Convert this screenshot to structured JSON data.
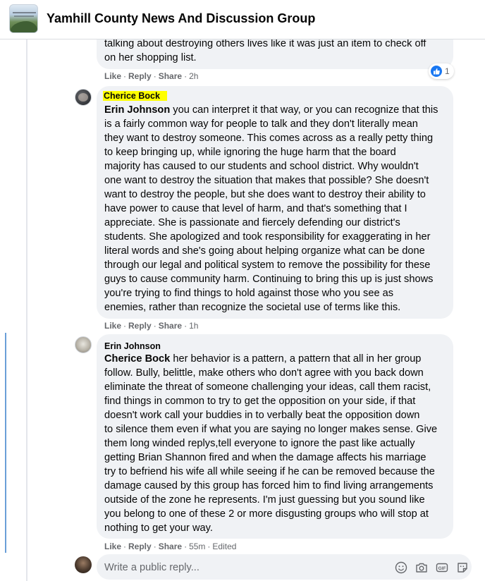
{
  "header": {
    "group_title": "Yamhill County News And Discussion Group"
  },
  "top_comment": {
    "lines": [
      "talking about destroying others lives like it was just an item to check off",
      "on her shopping list."
    ],
    "actions": {
      "like": "Like",
      "reply": "Reply",
      "share": "Share",
      "time": "2h"
    },
    "reaction": {
      "icon": "thumbs-up-icon",
      "count": "1",
      "color": "#1877f2"
    }
  },
  "cherice_comment": {
    "author": "Cherice Bock",
    "highlight_color": "#ffff00",
    "mention": "Erin Johnson",
    "first_line_rest": " you can interpret it that way, or you can recognize that this",
    "lines": [
      "is a fairly common way for people to talk and they don't literally mean",
      "they want to destroy someone. This comes across as a really petty thing",
      "to keep bringing up, while ignoring the huge harm that the board",
      "majority has caused to our students and school district. Why wouldn't",
      "one want to destroy the situation that makes that possible? She doesn't",
      "want to destroy the people, but she does want to destroy their ability to",
      "have power to cause that level of harm, and that's something that I",
      "appreciate. She is passionate and fiercely defending our district's",
      "students. She apologized and took responsibility for exaggerating in her",
      "literal words and she's going about helping organize what can be done",
      "through our legal and political system to remove the possibility for these",
      "guys to cause community harm. Continuing to bring this up is just shows",
      "you're trying to find things to hold against those who you see as",
      "enemies, rather than recognize the societal use of terms like this."
    ],
    "actions": {
      "like": "Like",
      "reply": "Reply",
      "share": "Share",
      "time": "1h"
    }
  },
  "erin_comment": {
    "author": "Erin Johnson",
    "mention": "Cherice Bock",
    "first_line_rest": " her behavior is a pattern, a pattern that all in her group",
    "lines": [
      "follow. Bully, belittle, make others who don't agree with you back down",
      "eliminate the threat of someone challenging your ideas, call them racist,",
      "find things in common to try to get the opposition on your side, if that",
      "doesn't work call your buddies in to verbally beat the opposition down",
      "to silence them even if what you are saying no longer makes sense. Give",
      "them long winded replys,tell everyone to ignore the past like actually",
      "getting Brian Shannon fired and when the damage affects his marriage",
      "try to befriend his wife all while seeing if he can be removed because the",
      "damage caused by this group has forced him to find living arrangements",
      "outside of the zone he represents. I'm just guessing but you sound like",
      "you belong to one of these 2 or more disgusting groups who will stop at",
      "nothing to get your way."
    ],
    "actions": {
      "like": "Like",
      "reply": "Reply",
      "share": "Share",
      "time": "55m",
      "edited": "Edited"
    }
  },
  "reply_box": {
    "placeholder": "Write a public reply...",
    "icons": [
      "emoji-icon",
      "camera-icon",
      "gif-icon",
      "sticker-icon"
    ]
  },
  "colors": {
    "bubble": "#f0f2f5",
    "meta_text": "#65676b",
    "thread_accent": "#6a9fd8"
  }
}
